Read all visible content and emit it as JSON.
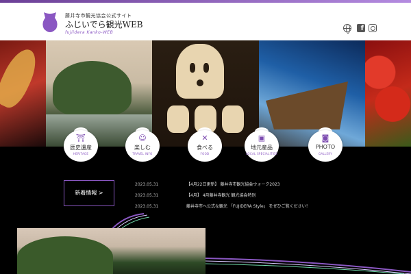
{
  "header": {
    "subtitle": "藤井寺市観光協会公式サイト",
    "title": "ふじいでら観光WEB",
    "roman": "fujiidera Kanko-WEB",
    "icons": [
      "globe-icon",
      "facebook-icon",
      "instagram-icon"
    ]
  },
  "categories": [
    {
      "label": "歴史遺産",
      "sub": "HERITAGE",
      "icon": "torii-icon",
      "glyph": "⛩"
    },
    {
      "label": "楽しむ",
      "sub": "TRAVEL INFO",
      "icon": "person-icon",
      "glyph": "☺"
    },
    {
      "label": "食べる",
      "sub": "FOOD",
      "icon": "fork-knife-icon",
      "glyph": "🍴"
    },
    {
      "label": "地元産品",
      "sub": "LOCAL SPECIALITIES",
      "icon": "gift-icon",
      "glyph": "🎁"
    },
    {
      "label": "PHOTO",
      "sub": "GALLERY",
      "icon": "camera-icon",
      "glyph": "📷"
    }
  ],
  "news": {
    "button_label": "新着情報 >",
    "items": [
      {
        "date": "2023.05.31",
        "text": "【4月22日更新】 藤井寺市観光協会ウォーク2023"
      },
      {
        "date": "2023.05.31",
        "text": "【4月】 4月藤井寺観光 観光協会特別"
      },
      {
        "date": "2023.05.31",
        "text": "藤井寺市へ公式な観光 「FUJIDERA Style」 をぜひご覧ください！"
      }
    ]
  },
  "colors": {
    "accent": "#8a57c2",
    "header_bg": "#ffffff",
    "page_bg": "#000000"
  }
}
